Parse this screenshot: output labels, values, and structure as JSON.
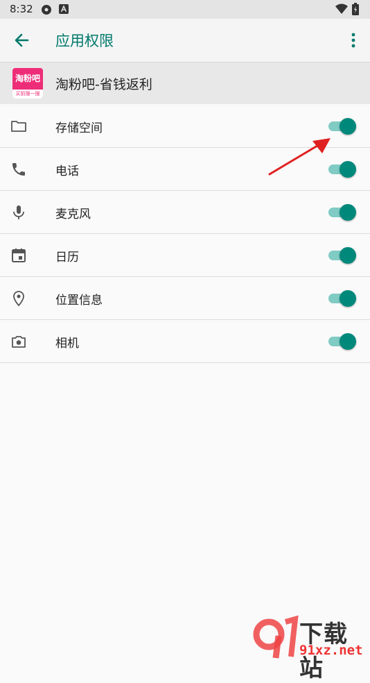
{
  "status_bar": {
    "time": "8:32"
  },
  "app_bar": {
    "title": "应用权限"
  },
  "app": {
    "name": "淘粉吧-省钱返利",
    "logo_text": "淘粉吧",
    "logo_subtext": "买前搜一搜"
  },
  "permissions": [
    {
      "label": "存储空间",
      "icon": "folder-icon",
      "enabled": true
    },
    {
      "label": "电话",
      "icon": "phone-icon",
      "enabled": true
    },
    {
      "label": "麦克风",
      "icon": "microphone-icon",
      "enabled": true
    },
    {
      "label": "日历",
      "icon": "calendar-icon",
      "enabled": true
    },
    {
      "label": "位置信息",
      "icon": "location-icon",
      "enabled": true
    },
    {
      "label": "相机",
      "icon": "camera-icon",
      "enabled": true
    }
  ],
  "watermark": {
    "text": "下载站",
    "site": "91xz.net"
  },
  "colors": {
    "accent": "#00796b",
    "toggle_track": "#80cbc4",
    "toggle_thumb": "#00897b",
    "arrow": "#e02020"
  }
}
